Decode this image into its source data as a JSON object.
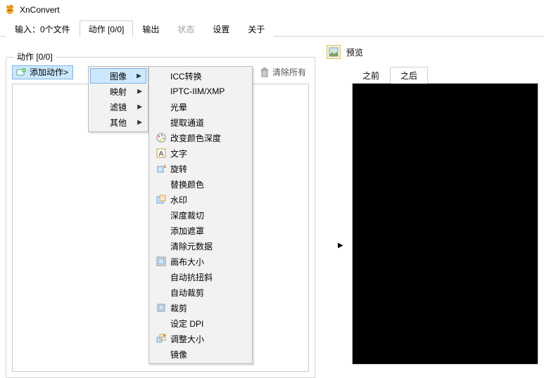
{
  "app": {
    "title": "XnConvert"
  },
  "tabs": {
    "input": "输入：0个文件",
    "actions": "动作 [0/0]",
    "output": "输出",
    "status": "状态",
    "settings": "设置",
    "about": "关于"
  },
  "panel": {
    "title": "动作 [0/0]",
    "add_label": "添加动作>",
    "clear_label": "清除所有"
  },
  "menu1": {
    "image": "图像",
    "map": "映射",
    "filter": "滤镜",
    "other": "其他"
  },
  "menu2": {
    "icc": "ICC转换",
    "iptc": "IPTC-IIM/XMP",
    "halo": "光晕",
    "extract_channel": "提取通道",
    "color_depth": "改变颜色深度",
    "text": "文字",
    "rotate": "旋转",
    "replace_color": "替换颜色",
    "watermark": "水印",
    "deep_crop": "深度裁切",
    "add_mask": "添加遮罩",
    "clear_meta": "清除元数据",
    "canvas_size": "画布大小",
    "deskew": "自动抗扭斜",
    "autocrop": "自动裁剪",
    "crop": "裁剪",
    "set_dpi": "设定 DPI",
    "resize": "调整大小",
    "mirror": "镜像"
  },
  "preview": {
    "label": "预览",
    "before": "之前",
    "after": "之后"
  }
}
